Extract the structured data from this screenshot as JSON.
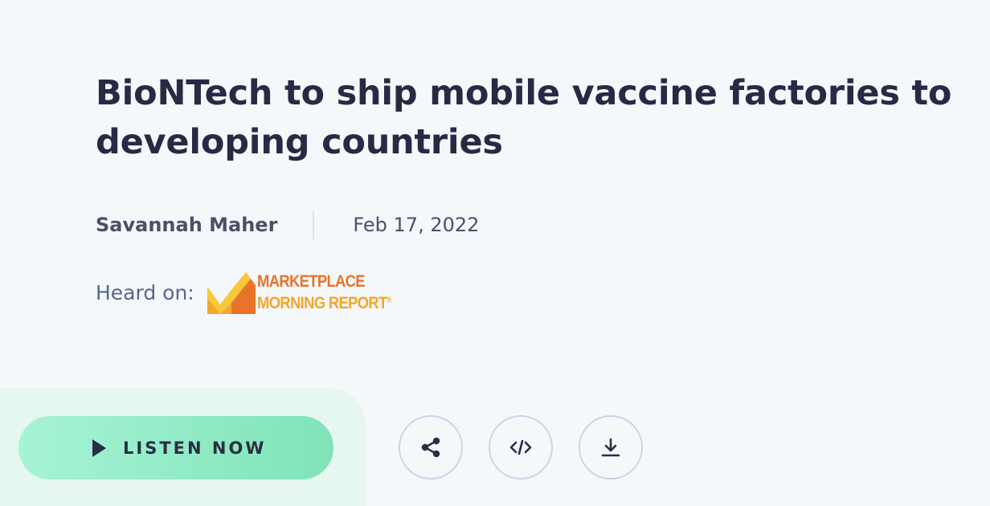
{
  "article": {
    "title": "BioNTech to ship mobile vaccine factories to developing countries",
    "author": "Savannah Maher",
    "date": "Feb 17, 2022"
  },
  "heard_on": {
    "label": "Heard on:",
    "show_logo": {
      "line1": "MARKETPLACE",
      "line2": "MORNING REPORT",
      "mark": "®"
    }
  },
  "actions": {
    "listen_label": "LISTEN NOW",
    "icons": {
      "play": "play-icon",
      "share": "share-icon",
      "embed": "code-icon",
      "download": "download-icon"
    }
  },
  "colors": {
    "background": "#f5f8fb",
    "headline": "#282a45",
    "listen_gradient_start": "#a6f3d6",
    "listen_gradient_end": "#7fe4b7",
    "listen_panel": "#e6f6f0",
    "circle_border": "#c9d4e6",
    "logo_orange": "#e8732a",
    "logo_yellow": "#f2a72e"
  }
}
